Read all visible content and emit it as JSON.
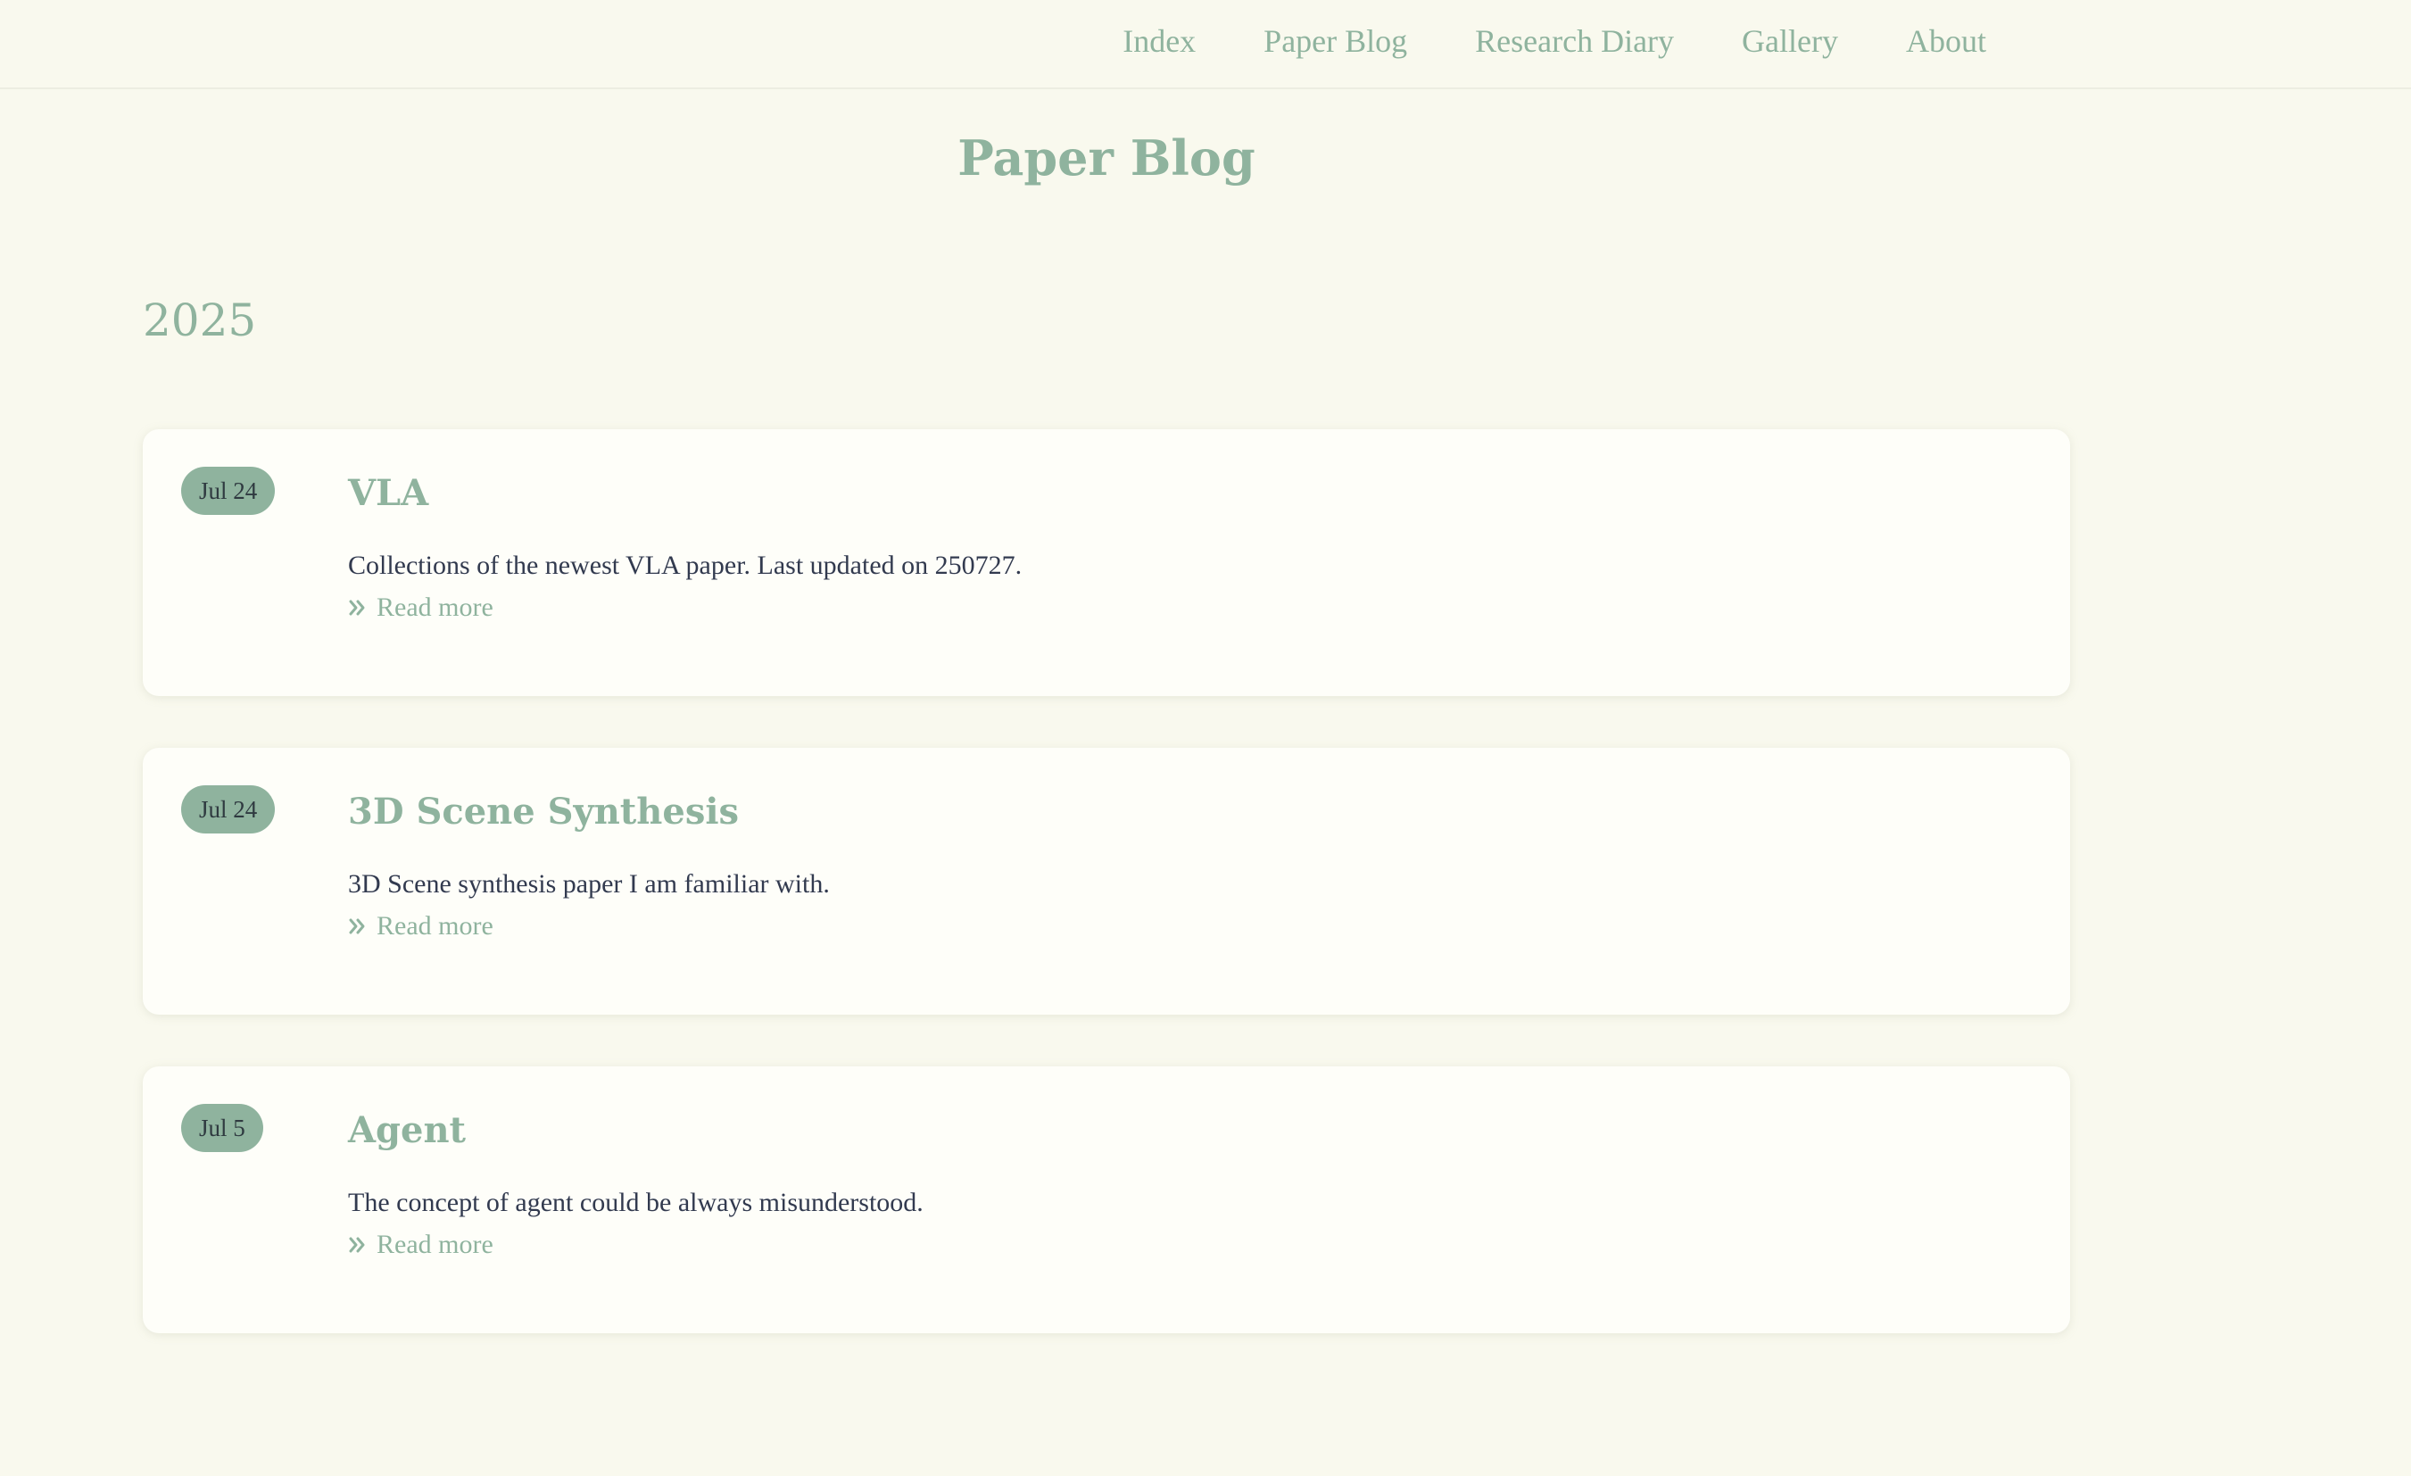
{
  "nav": {
    "items": [
      {
        "label": "Index"
      },
      {
        "label": "Paper Blog"
      },
      {
        "label": "Research Diary"
      },
      {
        "label": "Gallery"
      },
      {
        "label": "About"
      }
    ]
  },
  "page": {
    "title": "Paper Blog",
    "year": "2025"
  },
  "posts": [
    {
      "date": "Jul 24",
      "title": "VLA",
      "excerpt": "Collections of the newest VLA paper. Last updated on 250727.",
      "read_more": "Read more"
    },
    {
      "date": "Jul 24",
      "title": "3D Scene Synthesis",
      "excerpt": "3D Scene synthesis paper I am familiar with.",
      "read_more": "Read more"
    },
    {
      "date": "Jul 5",
      "title": "Agent",
      "excerpt": "The concept of agent could be always misunderstood.",
      "read_more": "Read more"
    }
  ],
  "colors": {
    "background": "#f9f9ee",
    "accent": "#8fb39e",
    "card": "#fefef9",
    "text": "#323a4f"
  },
  "icons": {
    "read_more": "double-chevron-right-icon"
  }
}
